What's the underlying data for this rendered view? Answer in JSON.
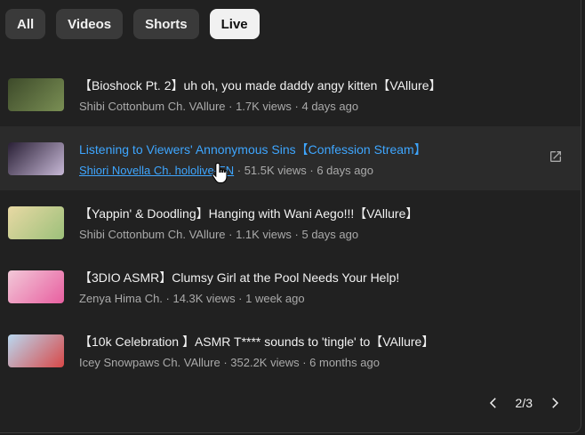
{
  "chips": [
    "All",
    "Videos",
    "Shorts",
    "Live"
  ],
  "active_chip": "Live",
  "videos": [
    {
      "title": "【Bioshock Pt. 2】uh oh, you made daddy angy kitten【VAllure】",
      "channel": "Shibi Cottonbum Ch. VAllure",
      "details": " · 1.7K views · 4 days ago",
      "thumb_colors": [
        "#3d4a2a",
        "#7a8f54"
      ]
    },
    {
      "title": "Listening to Viewers' Annonymous Sins【Confession Stream】",
      "channel": "Shiori Novella Ch. hololive-EN",
      "details": " · 51.5K views · 6 days ago",
      "thumb_colors": [
        "#2a2036",
        "#c7b8d6"
      ]
    },
    {
      "title": "【Yappin' & Doodling】Hanging with Wani Aego!!!【VAllure】",
      "channel": "Shibi Cottonbum Ch. VAllure",
      "details": " · 1.1K views · 5 days ago",
      "thumb_colors": [
        "#e8d9a4",
        "#9cc07a"
      ]
    },
    {
      "title": "【3DIO ASMR】Clumsy Girl at the Pool Needs Your Help!",
      "channel": "Zenya Hima Ch.",
      "details": " · 14.3K views · 1 week ago",
      "thumb_colors": [
        "#f2c8d8",
        "#e85fa0"
      ]
    },
    {
      "title": "【10k Celebration 】ASMR T**** sounds to 'tingle' to【VAllure】",
      "channel": "Icey Snowpaws Ch. VAllure",
      "details": " · 352.2K views · 6 months ago",
      "thumb_colors": [
        "#b9d8f0",
        "#d84848"
      ]
    }
  ],
  "pagination": {
    "label": "2/3"
  },
  "icons": {
    "external": "open-in-new-icon",
    "prev": "chevron-left-icon",
    "next": "chevron-right-icon",
    "cursor": "hand-pointer-cursor"
  }
}
